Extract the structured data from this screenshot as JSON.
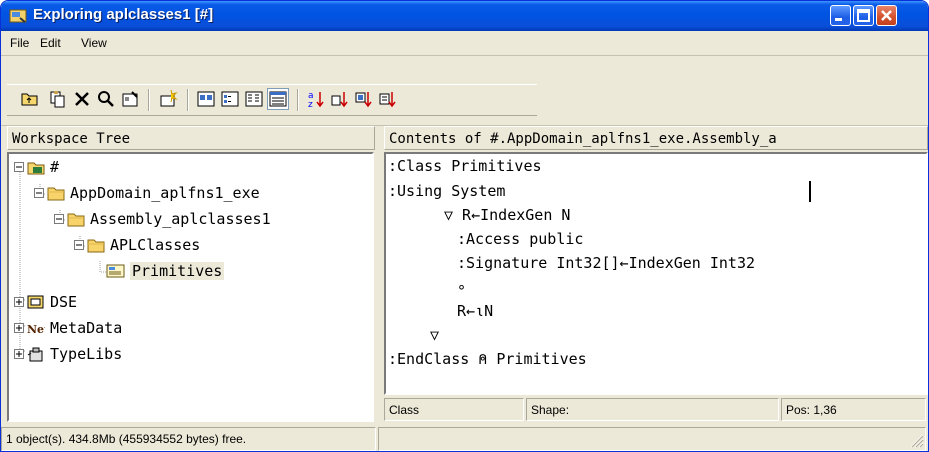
{
  "window": {
    "title": "Exploring aplclasses1 [#]"
  },
  "menu": [
    {
      "label": "File"
    },
    {
      "label": "Edit"
    },
    {
      "label": "View"
    }
  ],
  "toolbar": {
    "buttons": [
      {
        "icon": "up-folder-icon"
      },
      {
        "icon": "copy-icon"
      },
      {
        "icon": "delete-icon"
      },
      {
        "icon": "find-icon"
      },
      {
        "icon": "properties-icon"
      },
      {
        "icon": "new-object-icon"
      },
      {
        "icon": "large-icons-icon"
      },
      {
        "icon": "small-icons-icon"
      },
      {
        "icon": "list-view-icon"
      },
      {
        "icon": "details-view-icon"
      },
      {
        "icon": "sort-by-name-icon"
      },
      {
        "icon": "sort-by-type-icon"
      },
      {
        "icon": "sort-by-size-icon"
      },
      {
        "icon": "sort-by-date-icon"
      }
    ]
  },
  "left_pane": {
    "header": "Workspace Tree"
  },
  "right_pane": {
    "header": "Contents of #.AppDomain_aplfns1_exe.Assembly_a"
  },
  "tree": [
    {
      "label": "#",
      "expander": "minus",
      "icon": "workspace-icon"
    },
    {
      "label": "AppDomain_aplfns1_exe",
      "expander": "minus",
      "icon": "folder-icon"
    },
    {
      "label": "Assembly_aplclasses1",
      "expander": "minus",
      "icon": "folder-icon"
    },
    {
      "label": "APLClasses",
      "expander": "minus",
      "icon": "folder-icon"
    },
    {
      "label": "Primitives",
      "expander": "",
      "icon": "class-icon",
      "selected": true
    },
    {
      "label": "DSE",
      "expander": "plus",
      "icon": "session-icon"
    },
    {
      "label": "MetaData",
      "expander": "plus",
      "icon": "net-icon"
    },
    {
      "label": "TypeLibs",
      "expander": "plus",
      "icon": "typelib-icon"
    }
  ],
  "code": [
    ":Class Primitives",
    ":Using System",
    "▽ R←IndexGen N",
    ":Access public",
    ":Signature Int32[]←IndexGen Int32",
    "∘",
    "R←⍳N",
    "▽",
    ":EndClass ⍝ Primitives"
  ],
  "editor_status": {
    "class": "Class",
    "shape": "Shape:",
    "pos": "Pos: 1,36"
  },
  "status": {
    "free": "1 object(s). 434.8Mb (455934552 bytes) free.",
    "right": ""
  },
  "colors": {
    "titlebar": "#0054e3",
    "window_bg": "#ece9d8",
    "close": "#d2502c"
  }
}
